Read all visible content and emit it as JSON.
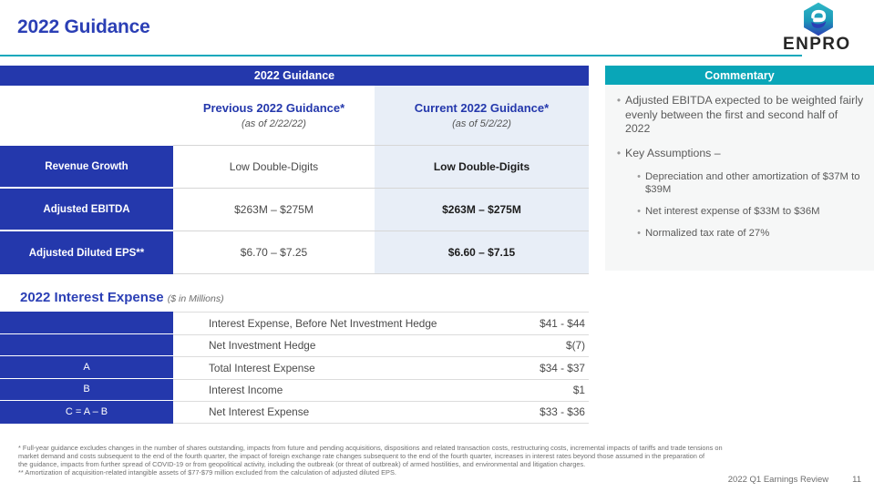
{
  "header": {
    "title": "2022 Guidance",
    "logo_text": "ENPRO",
    "accent_teal": "#12A8BC",
    "accent_blue": "#2438AC"
  },
  "guidance_table": {
    "banner": "2022 Guidance",
    "columns": [
      {
        "main": "",
        "sub": ""
      },
      {
        "main": "Previous 2022 Guidance*",
        "sub": "(as of 2/22/22)"
      },
      {
        "main": "Current 2022 Guidance*",
        "sub": "(as of 5/2/22)"
      }
    ],
    "rows": [
      {
        "label": "Revenue Growth",
        "previous": "Low Double-Digits",
        "current": "Low Double-Digits"
      },
      {
        "label": "Adjusted EBITDA",
        "previous": "$263M – $275M",
        "current": "$263M – $275M"
      },
      {
        "label": "Adjusted Diluted EPS**",
        "previous": "$6.70 – $7.25",
        "current": "$6.60 – $7.15"
      }
    ]
  },
  "commentary": {
    "banner": "Commentary",
    "bullets": [
      {
        "text": "Adjusted EBITDA expected to be weighted fairly evenly between the first and second half of 2022",
        "sub": []
      },
      {
        "text": "Key Assumptions –",
        "sub": [
          "Depreciation and other amortization of $37M to $39M",
          "Net interest expense of $33M to $36M",
          "Normalized tax rate of 27%"
        ]
      }
    ]
  },
  "interest_expense": {
    "title": "2022 Interest Expense",
    "unit": "($ in Millions)",
    "rows": [
      {
        "key": "",
        "description": "Interest Expense, Before Net Investment Hedge",
        "value": "$41 - $44"
      },
      {
        "key": "",
        "description": "Net Investment Hedge",
        "value": "$(7)"
      },
      {
        "key": "A",
        "description": "Total Interest Expense",
        "value": "$34 - $37"
      },
      {
        "key": "B",
        "description": "Interest Income",
        "value": "$1"
      },
      {
        "key": "C = A – B",
        "description": "Net Interest Expense",
        "value": "$33 - $36"
      }
    ]
  },
  "footnotes": {
    "line1": "* Full-year guidance excludes changes in the number of shares outstanding, impacts from future and pending acquisitions, dispositions and related transaction costs, restructuring costs, incremental impacts of tariffs and trade tensions on",
    "line2": "market demand and costs subsequent to the end of the fourth quarter, the impact of foreign exchange rate changes subsequent to the end of the fourth quarter, increases in interest rates beyond those assumed in the preparation of",
    "line3": "the guidance, impacts from further spread of COVID-19 or from geopolitical activity, including the outbreak (or threat of outbreak) of armed hostilities, and environmental and litigation charges.",
    "line4": "** Amortization of acquisition-related intangible assets of $77-$79 million excluded from the calculation of adjusted diluted EPS."
  },
  "page_footer": {
    "label": "2022 Q1 Earnings Review",
    "number": "11"
  }
}
